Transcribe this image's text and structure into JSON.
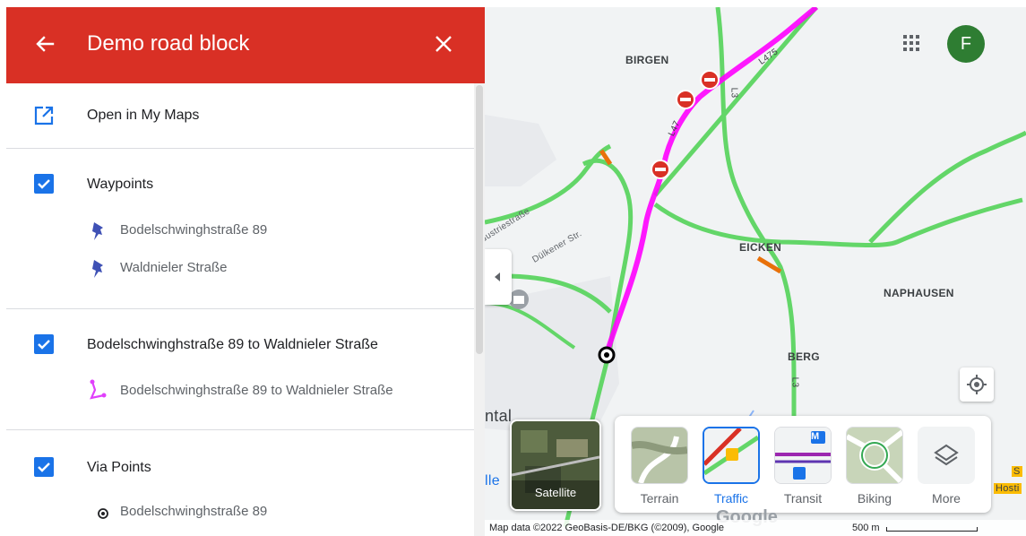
{
  "header": {
    "title": "Demo road block"
  },
  "open_in_my_maps": "Open in My Maps",
  "layers_list": [
    {
      "title": "Waypoints",
      "items": [
        "Bodelschwinghstraße 89",
        "Waldnieler Straße"
      ]
    },
    {
      "title": "Bodelschwinghstraße 89 to Waldnieler Straße",
      "items": [
        "Bodelschwinghstraße 89 to Waldnieler Straße"
      ]
    },
    {
      "title": "Via Points",
      "items": [
        "Bodelschwinghstraße 89"
      ]
    }
  ],
  "map": {
    "places": [
      "BIRGEN",
      "EICKEN",
      "NAPHAUSEN",
      "BERG",
      "ntal",
      "lle",
      "Hosti",
      "S"
    ],
    "streets": [
      "L475",
      "L47",
      "L3",
      "L3",
      "dustriestraße",
      "Dülkener Str."
    ],
    "avatar_letter": "F",
    "layer_options": [
      "Satellite",
      "Terrain",
      "Traffic",
      "Transit",
      "Biking",
      "More"
    ],
    "selected_layer": "Traffic",
    "transit_badge": "M",
    "attribution": "Map data ©2022 GeoBasis-DE/BKG (©2009), Google",
    "scale": "500 m",
    "google_logo": "Google"
  },
  "colors": {
    "header": "#d93025",
    "checkbox": "#1a73e8",
    "route": "#ff00ff",
    "traffic_green": "#63d668",
    "avatar": "#2e7d32"
  }
}
